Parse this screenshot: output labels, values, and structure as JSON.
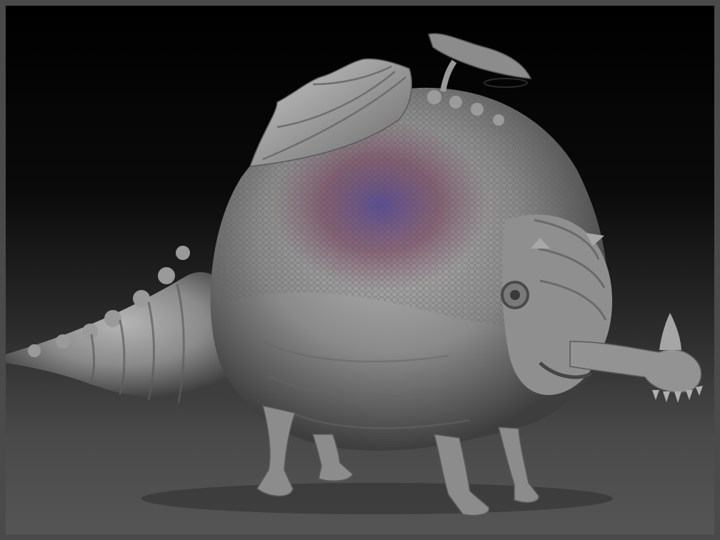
{
  "app": {
    "type": "3d-sculpt-viewport"
  },
  "viewport": {
    "background_top": "#000000",
    "background_bottom": "#555555",
    "frame_color": "#4a4a4a"
  },
  "model": {
    "subject_icon": "creature-sculpt",
    "material_color": "#8e8e8e",
    "polypaint_colors": [
      "#6a3a4a",
      "#4a4a8a",
      "#7a4a5a"
    ]
  }
}
